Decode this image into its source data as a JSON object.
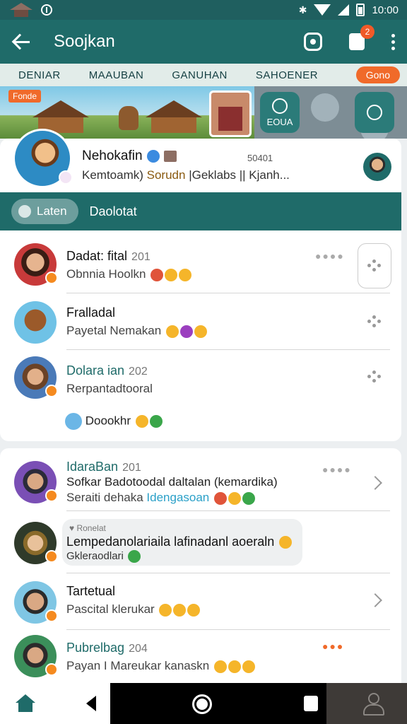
{
  "status_bar": {
    "time": "10:00"
  },
  "app_bar": {
    "title": "Soojkan",
    "cart_badge": "2"
  },
  "tabs": {
    "items": [
      "DENIAR",
      "MAAUBAN",
      "GANUHAN",
      "SAHOENER"
    ],
    "pill": "Gono"
  },
  "banner": {
    "tag": "Fonde",
    "button_label": "EOUA"
  },
  "profile": {
    "name": "Nehokafin",
    "count": "50401",
    "sub_prefix": "Kemtoamk) ",
    "sub_accent": "Sorudn",
    "sub_suffix": " |Geklabs || Kjanh..."
  },
  "filter": {
    "chip_label": "Laten",
    "label": "Daolotat"
  },
  "card1": {
    "rows": [
      {
        "title": "Dadat: fital",
        "num": "201",
        "sub": "Obnnia Hoolkn"
      },
      {
        "title": "Fralladal",
        "num": "",
        "sub": "Payetal Nemakan"
      },
      {
        "title": "Dolara ian",
        "num": "202",
        "sub": "Rerpantadtooral"
      }
    ],
    "footer_label": "Doookhr"
  },
  "card2": {
    "rows": [
      {
        "title": "IdaraBan",
        "num": "201",
        "line1": "Sofkar Badotoodal daltalan (kemardika)",
        "line2_prefix": "Seraiti dehaka ",
        "line2_link": "Idengasoan"
      },
      {
        "tag": "Ronelat",
        "line1": "Lempedanolariaila lafinadanl aoeraln",
        "line2": "Gkleraodlari"
      },
      {
        "title": "Tartetual",
        "num": "",
        "sub": "Pascital klerukar"
      },
      {
        "title": "Pubrelbag",
        "num": "204",
        "sub": "Payan I Mareukar kanaskn"
      }
    ]
  },
  "colors": {
    "primary": "#1f6b69",
    "accent": "#f06a2a",
    "background": "#eceff1"
  },
  "icons": [
    "back-arrow-icon",
    "camera-icon",
    "bag-icon",
    "more-vert-icon",
    "home-icon",
    "back-nav-icon",
    "home-nav-icon",
    "recents-icon",
    "person-icon"
  ]
}
